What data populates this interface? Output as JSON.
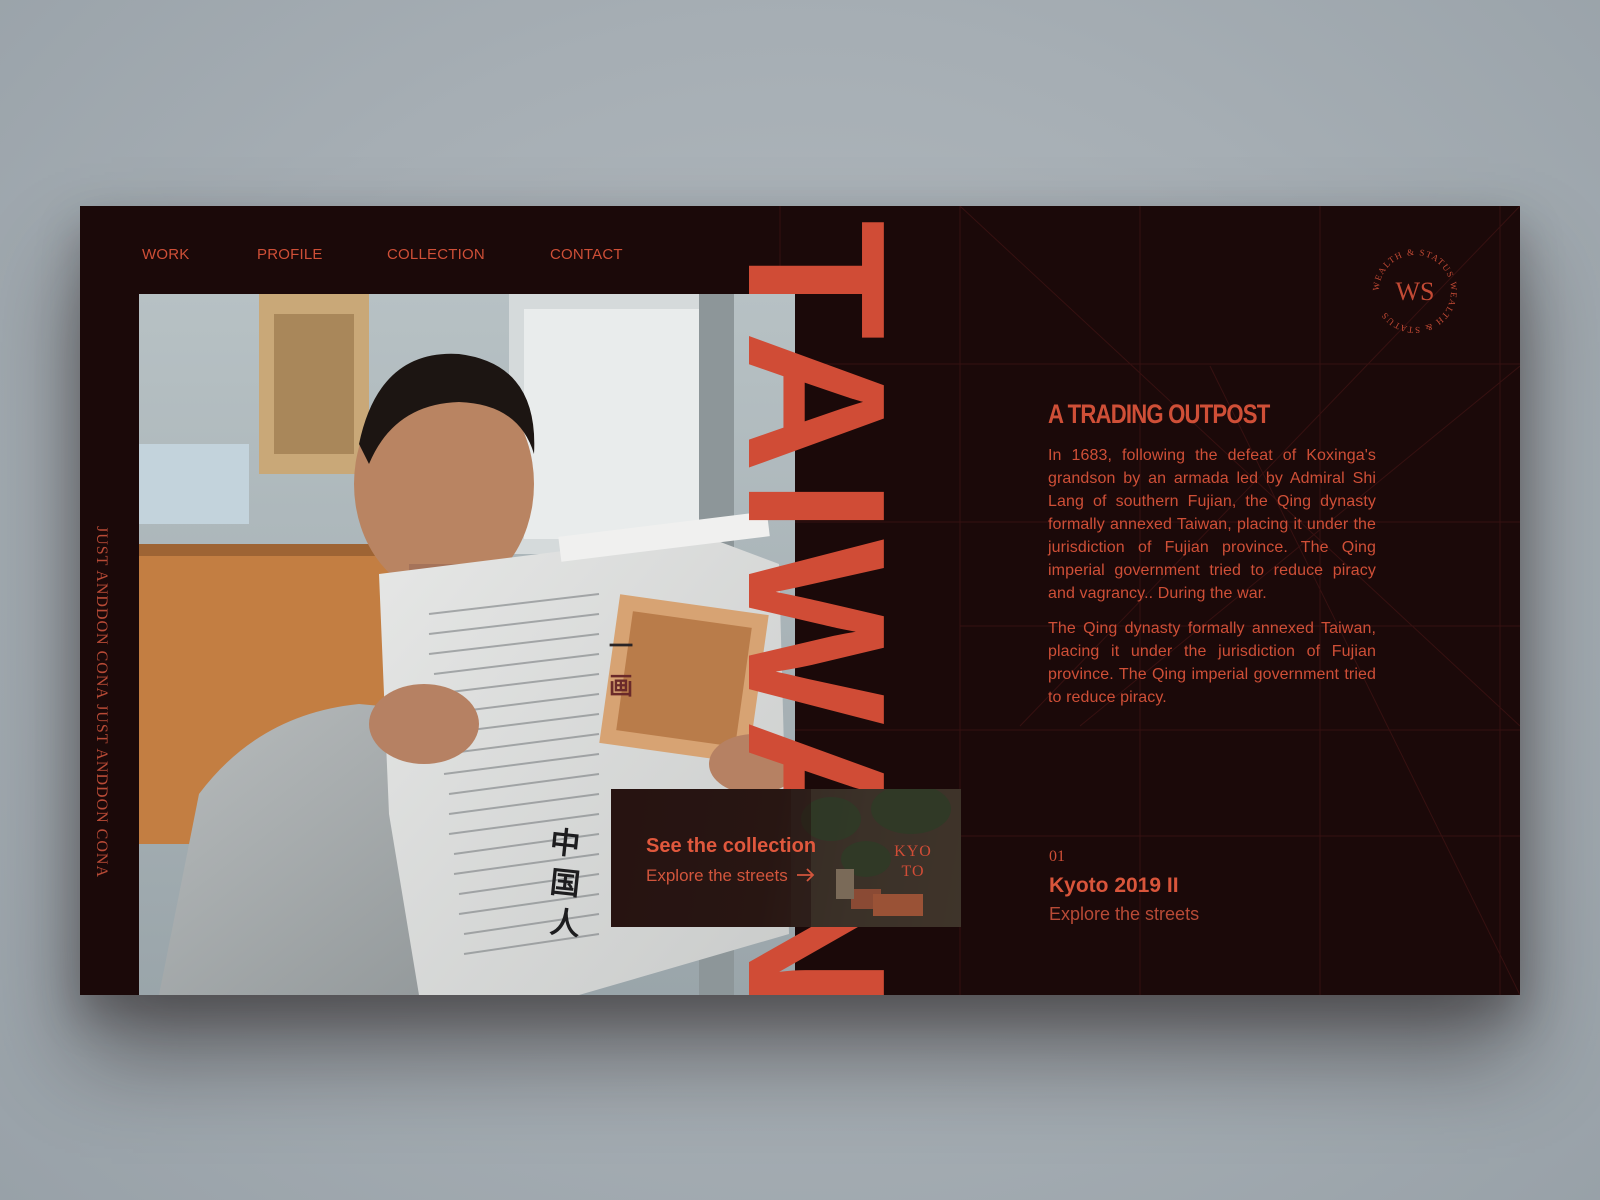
{
  "nav": {
    "items": [
      {
        "label": "WORK"
      },
      {
        "label": "PROFILE"
      },
      {
        "label": "COLLECTION"
      },
      {
        "label": "CONTACT"
      }
    ]
  },
  "hero": {
    "big_title": "TAIWAN",
    "side_text": "JUST ANDDON CONA JUST ANDDON CONA"
  },
  "logo": {
    "monogram": "WS",
    "ring_text": "WEALTH & STATUS WEALTH & STATUS"
  },
  "article": {
    "heading": "A TRADING OUTPOST",
    "paragraphs": [
      "In 1683, following the defeat of Koxinga's grandson by an armada led by Admiral Shi Lang of southern Fujian, the Qing dynasty formally annexed Taiwan, placing it under the jurisdiction of Fujian province. The Qing imperial government tried to reduce piracy and vagrancy.. During the war.",
      "The Qing dynasty formally annexed Taiwan, placing it under the jurisdiction of Fujian province. The Qing imperial government tried to reduce piracy."
    ]
  },
  "card": {
    "title": "See the collection",
    "link": "Explore the streets",
    "arrow": "arrow-right-icon",
    "thumb_label_1": "KYO",
    "thumb_label_2": "TO"
  },
  "caption": {
    "index": "01",
    "title": "Kyoto 2019 II",
    "link": "Explore the streets"
  },
  "colors": {
    "background": "#1b0909",
    "accent": "#cf4f37",
    "page": "#a6aeb4"
  }
}
